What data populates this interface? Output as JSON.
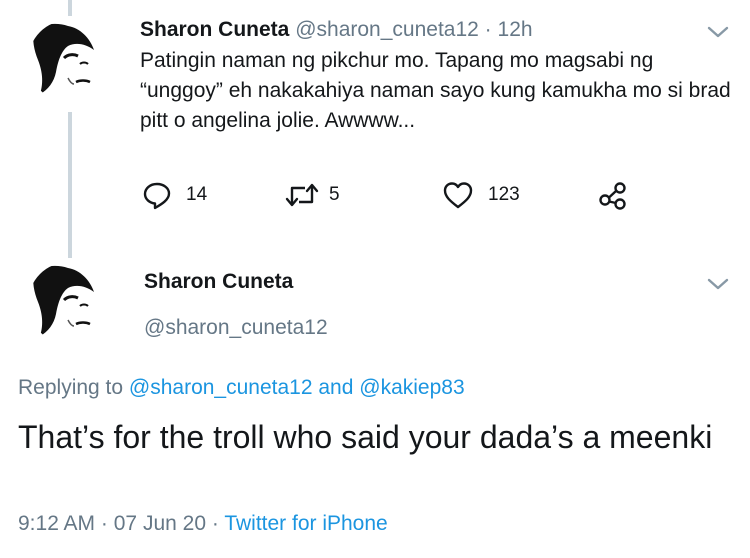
{
  "tweet1": {
    "name": "Sharon Cuneta",
    "handle": "@sharon_cuneta12",
    "separator": "·",
    "time": "12h",
    "text": "Patingin naman ng pikchur mo. Tapang mo magsabi ng “unggoy” eh nakakahiya naman sayo kung kamukha mo si brad pitt o angelina jolie. Awwww...",
    "replies": "14",
    "retweets": "5",
    "likes": "123"
  },
  "tweet2": {
    "name": "Sharon Cuneta",
    "handle": "@sharon_cuneta12",
    "replying_prefix": "Replying to",
    "replying_user1": "@sharon_cuneta12",
    "replying_and": "and",
    "replying_user2": "@kakiep83",
    "text": "That’s for the troll who said your dada’s a meenki",
    "time": "9:12 AM",
    "date": "07 Jun 20",
    "source": "Twitter for iPhone",
    "separator": "·"
  },
  "colors": {
    "text": "#14171a",
    "secondary": "#657786",
    "link": "#1b95e0",
    "thread_line": "#ccd6dd"
  },
  "icons": [
    "reply-icon",
    "retweet-icon",
    "like-icon",
    "share-icon",
    "chevron-down-icon"
  ]
}
